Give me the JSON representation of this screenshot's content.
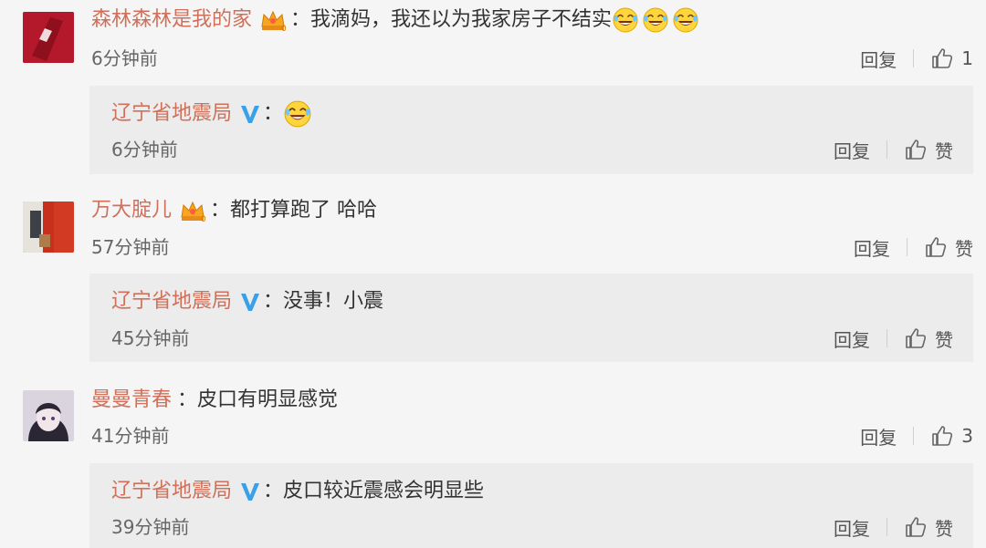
{
  "comments": [
    {
      "username": "森林森林是我的家",
      "text": "我滴妈，我还以为我家房子不结实",
      "emoji_icon": "laugh-cry-emoji",
      "emoji_count": 3,
      "time": "6分钟前",
      "reply_label": "回复",
      "like_count": "1",
      "reply": {
        "username": "辽宁省地震局",
        "text": "",
        "emoji_icon": "laugh-cry-emoji",
        "time": "6分钟前",
        "reply_label": "回复",
        "like_label": "赞"
      }
    },
    {
      "username": "万大腚儿",
      "text": "都打算跑了 哈哈",
      "time": "57分钟前",
      "reply_label": "回复",
      "like_label": "赞",
      "reply": {
        "username": "辽宁省地震局",
        "text": "没事！小震",
        "time": "45分钟前",
        "reply_label": "回复",
        "like_label": "赞"
      }
    },
    {
      "username": "曼曼青春",
      "text": "皮口有明显感觉",
      "time": "41分钟前",
      "reply_label": "回复",
      "like_count": "3",
      "reply": {
        "username": "辽宁省地震局",
        "text": "皮口较近震感会明显些",
        "time": "39分钟前",
        "reply_label": "回复",
        "like_label": "赞"
      }
    }
  ],
  "colon": "：",
  "colors": {
    "username": "#d0705a",
    "verified_badge": "#3aa0e8",
    "reply_bg": "#ececec",
    "page_bg": "#f5f5f5"
  }
}
